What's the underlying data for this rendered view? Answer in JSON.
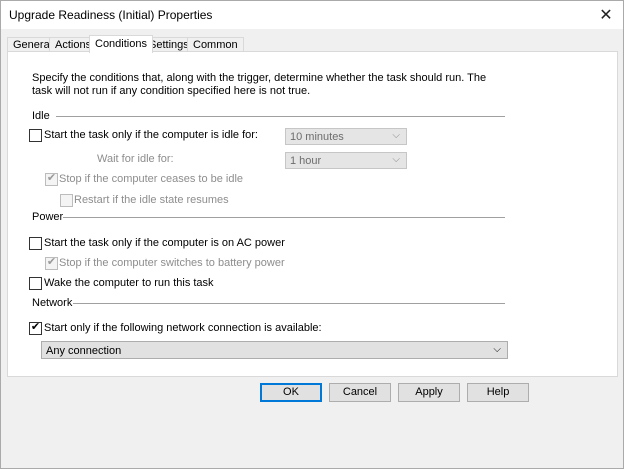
{
  "window": {
    "title": "Upgrade Readiness (Initial) Properties"
  },
  "tabs": [
    {
      "label": "General"
    },
    {
      "label": "Actions"
    },
    {
      "label": "Conditions"
    },
    {
      "label": "Settings"
    },
    {
      "label": "Common"
    }
  ],
  "active_tab": "Conditions",
  "description": "Specify the conditions that, along with the trigger, determine whether the task should run. The task will not run if any condition specified here is not true.",
  "idle": {
    "group_label": "Idle",
    "start_if_idle": {
      "label": "Start the task only if the computer is idle for:",
      "checked": false
    },
    "idle_duration": {
      "value": "10 minutes",
      "enabled": false
    },
    "wait_for_idle": {
      "label": "Wait for idle for:",
      "value": "1 hour",
      "enabled": false
    },
    "stop_if_not_idle": {
      "label": "Stop if the computer ceases to be idle",
      "checked": true,
      "enabled": false
    },
    "restart_if_idle": {
      "label": "Restart if the idle state resumes",
      "checked": false,
      "enabled": false
    }
  },
  "power": {
    "group_label": "Power",
    "ac_power": {
      "label": "Start the task only if the computer is on AC power",
      "checked": false
    },
    "stop_on_battery": {
      "label": "Stop if the computer switches to battery power",
      "checked": true,
      "enabled": false
    },
    "wake": {
      "label": "Wake the computer to run this task",
      "checked": false
    }
  },
  "network": {
    "group_label": "Network",
    "require_network": {
      "label": "Start only if the following network connection is available:",
      "checked": true
    },
    "connection": {
      "value": "Any connection"
    }
  },
  "buttons": {
    "ok": "OK",
    "cancel": "Cancel",
    "apply": "Apply",
    "help": "Help"
  },
  "icons": {
    "close": "close-icon",
    "chevron": "chevron-down-icon",
    "check": "checkmark-icon"
  },
  "colors": {
    "accent": "#0078d7",
    "separator": "#a0a0a0",
    "panel": "#ffffff",
    "dialog": "#f0f0f0"
  }
}
